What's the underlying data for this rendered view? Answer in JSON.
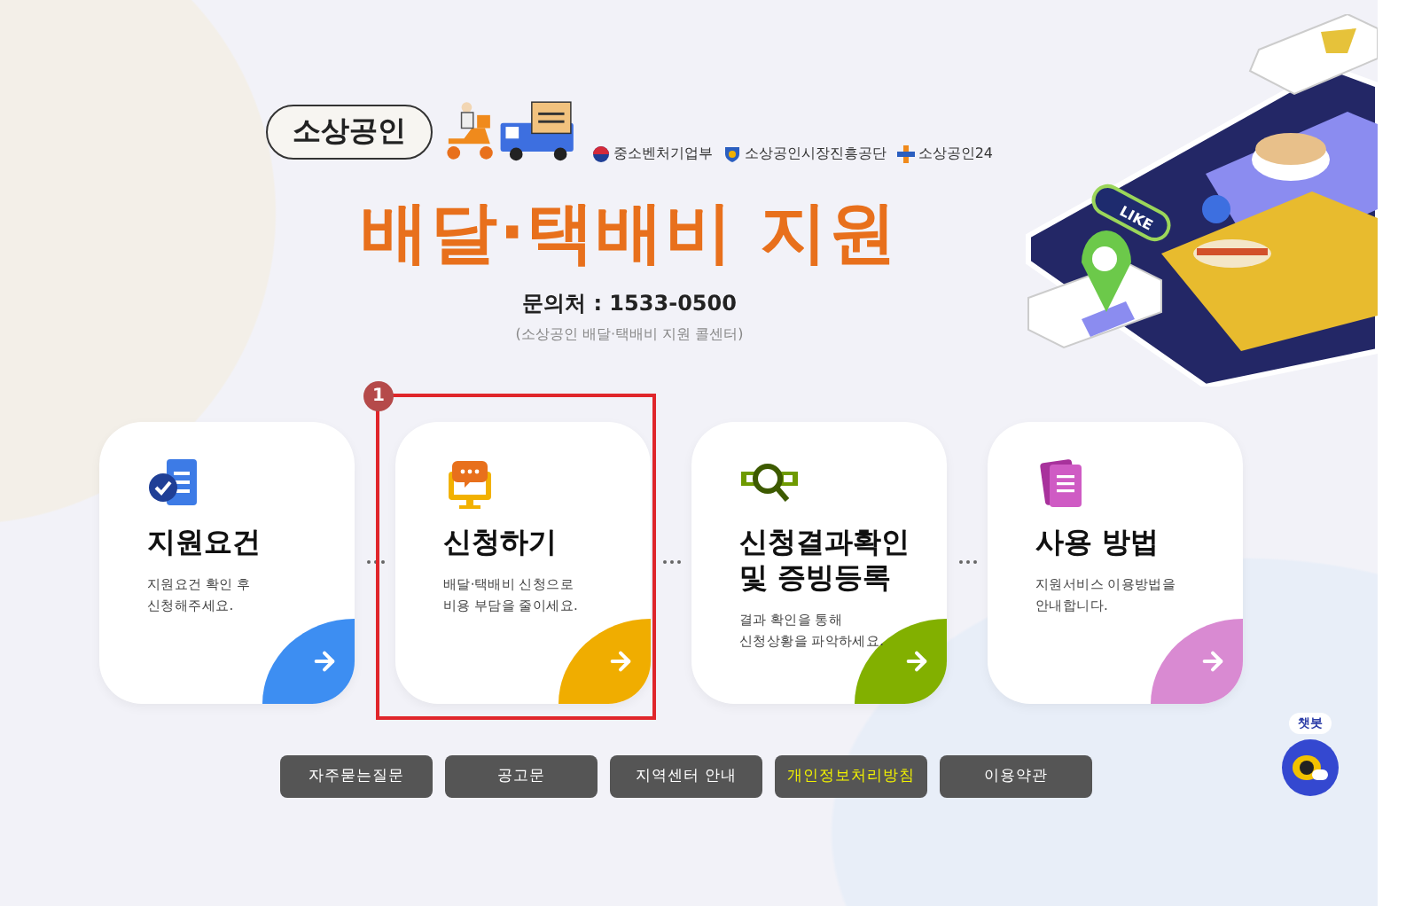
{
  "header": {
    "badge": "소상공인",
    "logos": [
      {
        "kind": "gov",
        "label": "중소벤처기업부"
      },
      {
        "kind": "agency",
        "label": "소상공인시장진흥공단"
      },
      {
        "kind": "portal",
        "label": "소상공인24"
      }
    ],
    "title": "배달·택배비 지원",
    "contact": "문의처 : 1533-0500",
    "contact_note": "(소상공인 배달·택배비 지원 콜센터)",
    "illustration_badge": "LIKE"
  },
  "cards": [
    {
      "kind": "requirements",
      "title": "지원요건",
      "description": "지원요건 확인 후\n신청해주세요.",
      "color": "#3d8ef2",
      "highlighted": false
    },
    {
      "kind": "apply",
      "title": "신청하기",
      "description": "배달·택배비 신청으로\n비용 부담을 줄이세요.",
      "color": "#f0ad00",
      "highlighted": true,
      "marker": "1"
    },
    {
      "kind": "result",
      "title": "신청결과확인\n및 증빙등록",
      "description": "결과 확인을 통해\n신청상황을 파악하세요.",
      "color": "#82b000",
      "highlighted": false
    },
    {
      "kind": "guide",
      "title": "사용 방법",
      "description": "지원서비스 이용방법을\n안내합니다.",
      "color": "#d98ad2",
      "highlighted": false
    }
  ],
  "links": [
    {
      "label": "자주묻는질문",
      "emphasized": false
    },
    {
      "label": "공고문",
      "emphasized": false
    },
    {
      "label": "지역센터 안내",
      "emphasized": false
    },
    {
      "label": "개인정보처리방침",
      "emphasized": true
    },
    {
      "label": "이용약관",
      "emphasized": false
    }
  ],
  "chatbot": {
    "label": "챗봇"
  }
}
